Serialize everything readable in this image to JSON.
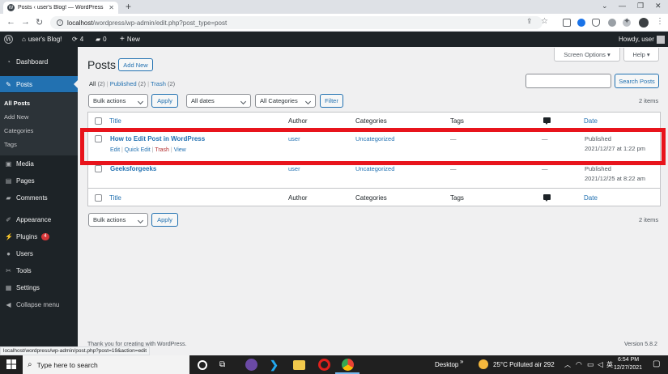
{
  "browser": {
    "tab_title": "Posts ‹ user's Blog! — WordPress",
    "url_host": "localhost",
    "url_path": "/wordpress/wp-admin/edit.php?post_type=post"
  },
  "adminbar": {
    "site_name": "user's Blog!",
    "updates": "4",
    "comments": "0",
    "new": "New",
    "howdy": "Howdy, user"
  },
  "sidebar": {
    "items": {
      "dashboard": "Dashboard",
      "posts": "Posts",
      "media": "Media",
      "pages": "Pages",
      "comments": "Comments",
      "appearance": "Appearance",
      "plugins": "Plugins",
      "plugins_badge": "4",
      "users": "Users",
      "tools": "Tools",
      "settings": "Settings",
      "collapse": "Collapse menu"
    },
    "submenu": {
      "all_posts": "All Posts",
      "add_new": "Add New",
      "categories": "Categories",
      "tags": "Tags"
    }
  },
  "screen_meta": {
    "screen_options": "Screen Options ▾",
    "help": "Help ▾"
  },
  "page": {
    "title": "Posts",
    "add_new": "Add New",
    "filter_all": "All",
    "filter_all_count": "(2)",
    "filter_published": "Published",
    "filter_published_count": "(2)",
    "filter_trash": "Trash",
    "filter_trash_count": "(2)",
    "separator": "|",
    "search_button": "Search Posts",
    "search_value": ""
  },
  "tablenav_top": {
    "bulk_actions": "Bulk actions",
    "apply": "Apply",
    "dates": "All dates",
    "categories": "All Categories",
    "filter": "Filter",
    "items": "2 items"
  },
  "table": {
    "headers": {
      "title": "Title",
      "author": "Author",
      "categories": "Categories",
      "tags": "Tags",
      "date": "Date"
    },
    "rows": [
      {
        "title": "How to Edit Post in WordPress",
        "author": "user",
        "category": "Uncategorized",
        "tags": "—",
        "comments": "—",
        "status": "Published",
        "date": "2021/12/27 at 1:22 pm",
        "actions": {
          "edit": "Edit",
          "quick_edit": "Quick Edit",
          "trash": "Trash",
          "view": "View"
        }
      },
      {
        "title": "Geeksforgeeks",
        "author": "user",
        "category": "Uncategorized",
        "tags": "—",
        "comments": "—",
        "status": "Published",
        "date": "2021/12/25 at 8:22 am"
      }
    ]
  },
  "tablenav_bottom": {
    "bulk_actions": "Bulk actions",
    "apply": "Apply",
    "items": "2 items"
  },
  "footer": {
    "thanks": "Thank you for creating with WordPress.",
    "version": "Version 5.8.2"
  },
  "status_url": "localhost/wordpress/wp-admin/post.php?post=19&action=edit",
  "taskbar": {
    "search_placeholder": "Type here to search",
    "desktop": "Desktop",
    "weather": "25°C  Polluted air 292",
    "time": "6:54 PM",
    "date": "12/27/2021"
  },
  "colors": {
    "wp_blue": "#2271b1",
    "admin_dark": "#1d2327",
    "highlight_red": "#e8141c",
    "trash_red": "#b32d2e"
  }
}
